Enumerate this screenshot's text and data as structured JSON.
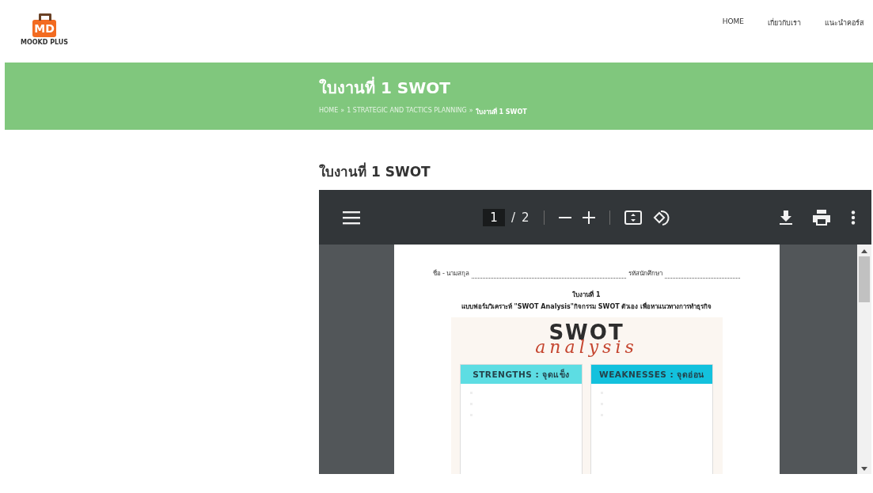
{
  "logo": {
    "mark": "MD",
    "name": "MOOKD PLUS"
  },
  "nav": [
    "HOME",
    "เกี่ยวกับเรา",
    "แนะนำคอร์ส"
  ],
  "banner": {
    "title": "ใบงานที่ 1 SWOT",
    "breadcrumb": [
      "HOME",
      "1 STRATEGIC AND TACTICS PLANNING",
      "ใบงานที่ 1 SWOT"
    ],
    "separator": "»"
  },
  "heading": "ใบงานที่ 1 SWOT",
  "pdf_viewer": {
    "page": "1",
    "separator": "/",
    "total_pages": "2",
    "document": {
      "name_label": "ชื่อ - นามสกุล",
      "id_label": "รหัสนักศึกษา",
      "title": "ใบงานที่ 1",
      "subtitle": "แบบฟอร์มวิเคราะห์ \"SWOT Analysis\"กิจกรรม SWOT ตัวเอง เพื่อหาแนวทางการทำธุรกิจ",
      "card": {
        "title": "SWOT",
        "script": "analysis",
        "boxes": [
          {
            "label": "STRENGTHS : จุดแข็ง",
            "color": "#5ddde3"
          },
          {
            "label": "WEAKNESSES : จุดอ่อน",
            "color": "#13c1dd"
          }
        ]
      }
    }
  }
}
